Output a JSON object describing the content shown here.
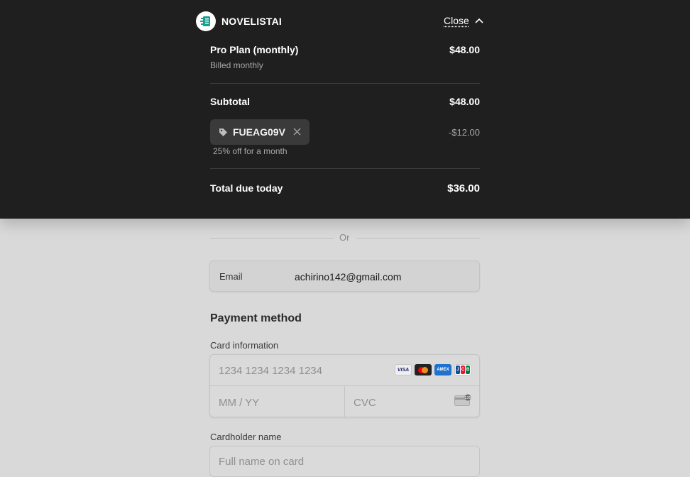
{
  "header": {
    "brand_name": "NOVELISTAI",
    "close_label": "Close"
  },
  "summary": {
    "plan_name": "Pro Plan (monthly)",
    "plan_price": "$48.00",
    "plan_billing": "Billed monthly",
    "subtotal_label": "Subtotal",
    "subtotal_amount": "$48.00",
    "promo_code": "FUEAG09V",
    "promo_description": "25% off for a month",
    "discount_amount": "-$12.00",
    "total_label": "Total due today",
    "total_amount": "$36.00"
  },
  "form": {
    "or_label": "Or",
    "email_label": "Email",
    "email_value": "achirino142@gmail.com",
    "payment_method_title": "Payment method",
    "card_info_label": "Card information",
    "card_number_placeholder": "1234 1234 1234 1234",
    "expiry_placeholder": "MM / YY",
    "cvc_placeholder": "CVC",
    "card_brands": [
      "visa",
      "mastercard",
      "amex",
      "jcb"
    ],
    "visa_text": "VISA",
    "amex_text": "AMEX",
    "jcb_letters": [
      "J",
      "C",
      "B"
    ],
    "cardholder_label": "Cardholder name",
    "cardholder_placeholder": "Full name on card"
  },
  "colors": {
    "overlay_bg": "#1f1f1f",
    "page_bg": "#d9d9d9",
    "logo_teal": "#1a9e8f"
  }
}
